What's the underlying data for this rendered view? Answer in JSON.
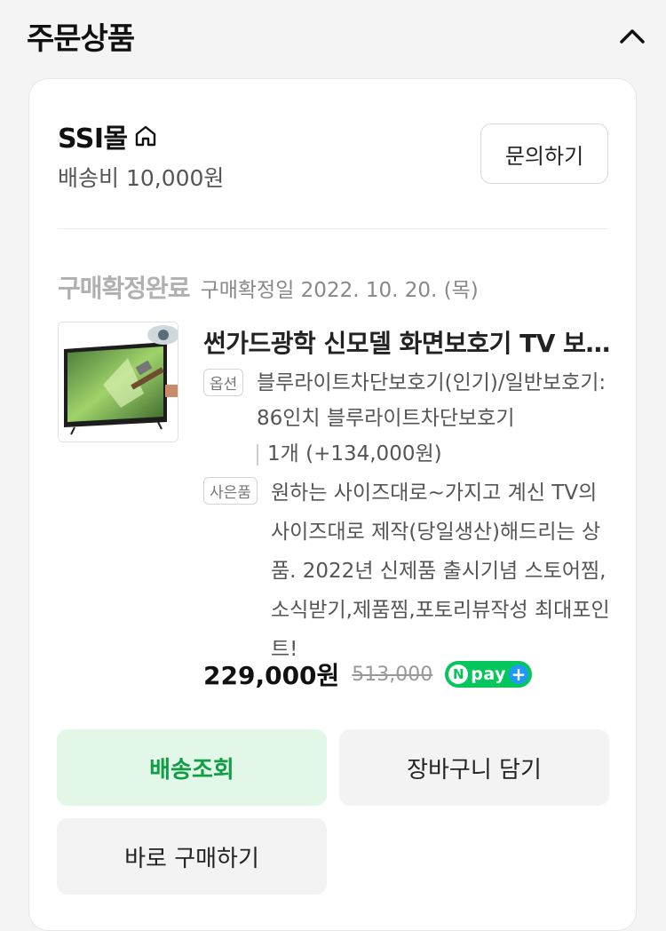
{
  "header": {
    "title": "주문상품",
    "collapse_icon": "chevron-up-icon"
  },
  "store": {
    "name": "SSI몰",
    "home_icon": "home-icon",
    "shipping_fee": "배송비 10,000원",
    "inquiry_label": "문의하기"
  },
  "order": {
    "status": "구매확정완료",
    "confirm_date": "구매확정일 2022. 10. 20. (목)"
  },
  "product": {
    "title": "썬가드광학 신모델 화면보호기 TV 보...",
    "option_tag": "옵션",
    "option_text": "블루라이트차단보호기(인기)/일반보호기: 86인치 블루라이트차단보호기",
    "quantity_text": "1개 (+134,000원)",
    "gift_tag": "사은품",
    "gift_text": "원하는 사이즈대로~가지고 계신 TV의 사이즈대로 제작(당일생산)해드리는 상품. 2022년 신제품 출시기념 스토어찜,소식받기,제품찜,포토리뷰작성 최대포인트!",
    "price": "229,000원",
    "original_price": "513,000",
    "npay": {
      "n": "N",
      "label": "pay",
      "plus": "+"
    }
  },
  "actions": {
    "track_delivery": "배송조회",
    "add_to_cart": "장바구니 담기",
    "buy_now": "바로 구매하기"
  },
  "colors": {
    "accent_green": "#03c75a",
    "track_bg": "#e2f7e8",
    "track_text": "#0f9d45",
    "npay_plus": "#1e9af5"
  }
}
